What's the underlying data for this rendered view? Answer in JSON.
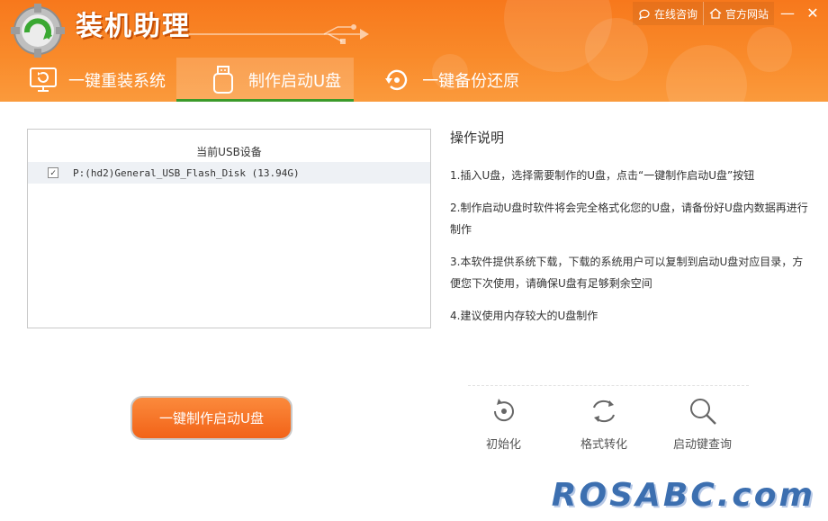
{
  "app": {
    "title": "装机助理"
  },
  "top_links": [
    {
      "label": "在线咨询",
      "icon": "chat-icon"
    },
    {
      "label": "官方网站",
      "icon": "home-icon"
    }
  ],
  "window": {
    "minimize": "—",
    "close": "✕"
  },
  "tabs": [
    {
      "label": "一键重装系统",
      "icon": "monitor-refresh-icon",
      "active": false
    },
    {
      "label": "制作启动U盘",
      "icon": "usb-drive-icon",
      "active": true
    },
    {
      "label": "一键备份还原",
      "icon": "backup-restore-icon",
      "active": false
    }
  ],
  "device_list": {
    "header": "当前USB设备",
    "items": [
      {
        "label": "P:(hd2)General_USB_Flash_Disk (13.94G)",
        "checked": true
      }
    ]
  },
  "instructions": {
    "title": "操作说明",
    "steps": [
      "1.插入U盘，选择需要制作的U盘，点击“一键制作启动U盘”按钮",
      "2.制作启动U盘时软件将会完全格式化您的U盘，请备份好U盘内数据再进行制作",
      "3.本软件提供系统下载，下载的系统用户可以复制到启动U盘对应目录，方便您下次使用，请确保U盘有足够剩余空间",
      "4.建议使用内存较大的U盘制作"
    ]
  },
  "actions": {
    "make_button": "一键制作启动U盘"
  },
  "tools": [
    {
      "label": "初始化",
      "icon": "reset-icon"
    },
    {
      "label": "格式转化",
      "icon": "convert-icon"
    },
    {
      "label": "启动键查询",
      "icon": "search-icon"
    }
  ],
  "watermark": "ROSABC.com",
  "colors": {
    "header": "#f7781c",
    "active_tab_underline": "#3b9a2a",
    "button": "#f26318"
  }
}
